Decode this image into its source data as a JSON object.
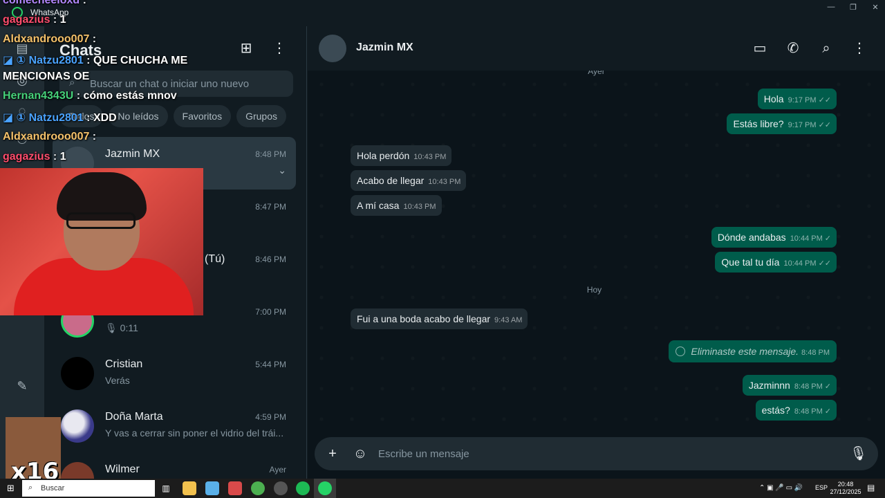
{
  "window": {
    "title": "WhatsApp",
    "controls": [
      "—",
      "❐",
      "✕"
    ]
  },
  "sidebar": {
    "title": "Chats",
    "search_placeholder": "Buscar un chat o iniciar uno nuevo",
    "filters": [
      "Todos",
      "No leídos",
      "Favoritos",
      "Grupos"
    ],
    "chats": [
      {
        "name": "Jazmin MX",
        "time": "8:48 PM",
        "preview": "",
        "active": true
      },
      {
        "name": "",
        "time": "8:47 PM",
        "preview": ""
      },
      {
        "name": "(Tú)",
        "time": "8:46 PM",
        "preview": ""
      },
      {
        "name": "",
        "time": "7:00 PM",
        "preview": "0:11"
      },
      {
        "name": "Cristian",
        "time": "5:44 PM",
        "preview": "Verás"
      },
      {
        "name": "Doña Marta",
        "time": "4:59 PM",
        "preview": "Y vas a cerrar sin poner el vidrio del trái..."
      },
      {
        "name": "Wilmer",
        "time": "Ayer",
        "preview": ""
      }
    ]
  },
  "chat": {
    "contact_name": "Jazmin MX",
    "day_labels": {
      "ayer": "Ayer",
      "hoy": "Hoy"
    },
    "messages": [
      {
        "dir": "out",
        "text": "Hola",
        "time": "9:17 PM",
        "ticks": "✓✓"
      },
      {
        "dir": "out",
        "text": "Estás libre?",
        "time": "9:17 PM",
        "ticks": "✓✓"
      },
      {
        "dir": "in",
        "text": "Hola perdón",
        "time": "10:43 PM"
      },
      {
        "dir": "in",
        "text": "Acabo de llegar",
        "time": "10:43 PM"
      },
      {
        "dir": "in",
        "text": "A mí casa",
        "time": "10:43 PM"
      },
      {
        "dir": "out",
        "text": "Dónde andabas",
        "time": "10:44 PM",
        "ticks": "✓"
      },
      {
        "dir": "out",
        "text": "Que tal tu día",
        "time": "10:44 PM",
        "ticks": "✓✓"
      },
      {
        "dir": "in",
        "text": "Fui a una boda acabo de llegar",
        "time": "9:43 AM"
      },
      {
        "dir": "out",
        "text": "Eliminaste este mensaje.",
        "time": "8:48 PM",
        "deleted": true
      },
      {
        "dir": "out",
        "text": "Jazminnn",
        "time": "8:48 PM",
        "ticks": "✓"
      },
      {
        "dir": "out",
        "text": "estás?",
        "time": "8:48 PM",
        "ticks": "✓"
      }
    ],
    "composer_placeholder": "Escribe un mensaje"
  },
  "stream_overlay": {
    "lines": [
      {
        "user": "comecheeloxd",
        "user_color": "#b388ff",
        "msg": ""
      },
      {
        "user": "gagazius",
        "user_color": "#ff4d6d",
        "msg": "1"
      },
      {
        "user": "Aldxandrooo007",
        "user_color": "#f5c26b",
        "msg": ""
      },
      {
        "user": "Natzu2801",
        "user_color": "#4aa3ff",
        "msg": "QUE CHUCHA ME"
      },
      {
        "user": "",
        "user_color": "#ffffff",
        "msg": "MENCIONAS OE"
      },
      {
        "user": "Hernan4343U",
        "user_color": "#46d17a",
        "msg": "cómo estás mnov"
      },
      {
        "user": "Natzu2801",
        "user_color": "#4aa3ff",
        "msg": "XDD"
      },
      {
        "user": "Aldxandrooo007",
        "user_color": "#f5c26b",
        "msg": ""
      },
      {
        "user": "gagazius",
        "user_color": "#ff4d6d",
        "msg": "1"
      }
    ],
    "sticker_label": "x16"
  },
  "taskbar": {
    "search_label": "Buscar",
    "language": "ESP",
    "time": "20:48",
    "date": "27/12/2025"
  },
  "colors": {
    "accent": "#25d366",
    "outgoing_bubble": "#005c4b",
    "incoming_bubble": "#202c33",
    "background": "#0b141a"
  }
}
